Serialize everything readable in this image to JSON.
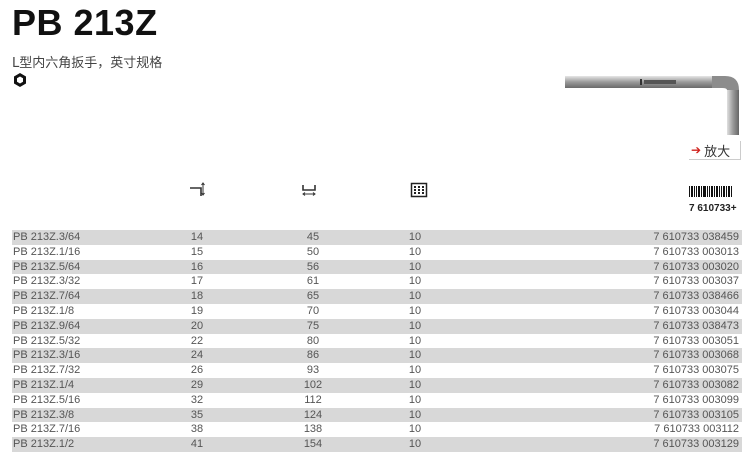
{
  "title": "PB 213Z",
  "subtitle": "L型内六角扳手，英寸规格",
  "icons": {
    "profile": "hexagon-socket-icon",
    "long_leg": "long-leg-length-icon",
    "short_leg": "short-leg-length-icon",
    "pack": "pack-quantity-icon",
    "barcode": "barcode-icon"
  },
  "zoom_label": "放大",
  "barcode_prefix": "7 610733+",
  "colors": {
    "row_shade": "#d8d8d8",
    "accent": "#d0211c"
  },
  "rows": [
    {
      "code": "PB 213Z.3/64",
      "l1": "14",
      "l2": "45",
      "pack": "10",
      "ean": "7 610733 038459"
    },
    {
      "code": "PB 213Z.1/16",
      "l1": "15",
      "l2": "50",
      "pack": "10",
      "ean": "7 610733 003013"
    },
    {
      "code": "PB 213Z.5/64",
      "l1": "16",
      "l2": "56",
      "pack": "10",
      "ean": "7 610733 003020"
    },
    {
      "code": "PB 213Z.3/32",
      "l1": "17",
      "l2": "61",
      "pack": "10",
      "ean": "7 610733 003037"
    },
    {
      "code": "PB 213Z.7/64",
      "l1": "18",
      "l2": "65",
      "pack": "10",
      "ean": "7 610733 038466"
    },
    {
      "code": "PB 213Z.1/8",
      "l1": "19",
      "l2": "70",
      "pack": "10",
      "ean": "7 610733 003044"
    },
    {
      "code": "PB 213Z.9/64",
      "l1": "20",
      "l2": "75",
      "pack": "10",
      "ean": "7 610733 038473"
    },
    {
      "code": "PB 213Z.5/32",
      "l1": "22",
      "l2": "80",
      "pack": "10",
      "ean": "7 610733 003051"
    },
    {
      "code": "PB 213Z.3/16",
      "l1": "24",
      "l2": "86",
      "pack": "10",
      "ean": "7 610733 003068"
    },
    {
      "code": "PB 213Z.7/32",
      "l1": "26",
      "l2": "93",
      "pack": "10",
      "ean": "7 610733 003075"
    },
    {
      "code": "PB 213Z.1/4",
      "l1": "29",
      "l2": "102",
      "pack": "10",
      "ean": "7 610733 003082"
    },
    {
      "code": "PB 213Z.5/16",
      "l1": "32",
      "l2": "112",
      "pack": "10",
      "ean": "7 610733 003099"
    },
    {
      "code": "PB 213Z.3/8",
      "l1": "35",
      "l2": "124",
      "pack": "10",
      "ean": "7 610733 003105"
    },
    {
      "code": "PB 213Z.7/16",
      "l1": "38",
      "l2": "138",
      "pack": "10",
      "ean": "7 610733 003112"
    },
    {
      "code": "PB 213Z.1/2",
      "l1": "41",
      "l2": "154",
      "pack": "10",
      "ean": "7 610733 003129"
    }
  ]
}
